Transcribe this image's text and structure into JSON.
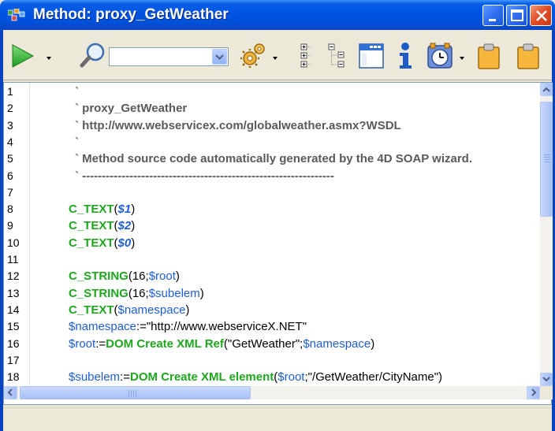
{
  "window": {
    "title": "Method: proxy_GetWeather",
    "title_icon": "method-icon",
    "controls": [
      "minimize-icon",
      "maximize-icon",
      "close-icon"
    ]
  },
  "toolbar": {
    "run": {
      "icon": "run-icon",
      "has_dropdown": true
    },
    "search": {
      "icon": "magnifier-icon",
      "value": ""
    },
    "settings": {
      "icon": "gears-icon",
      "has_dropdown": true
    },
    "collapse": {
      "icon": "collapse-tree-icon"
    },
    "expand": {
      "icon": "expand-tree-icon"
    },
    "form": {
      "icon": "window-form-icon"
    },
    "info": {
      "icon": "info-icon"
    },
    "clock": {
      "icon": "timer-icon",
      "has_dropdown": true
    },
    "clip1": {
      "icon": "clipboard-icon"
    },
    "clip2": {
      "icon": "clipboard-icon"
    }
  },
  "editor": {
    "line_numbers": [
      "1",
      "2",
      "3",
      "4",
      "5",
      "6",
      "7",
      "8",
      "9",
      "10",
      "11",
      "12",
      "13",
      "14",
      "15",
      "16",
      "17",
      "18"
    ],
    "lines": [
      {
        "parts": [
          {
            "t": "`",
            "c": "comment"
          }
        ],
        "indent": 56
      },
      {
        "parts": [
          {
            "t": "` proxy_GetWeather",
            "c": "comment"
          }
        ],
        "indent": 56
      },
      {
        "parts": [
          {
            "t": "` http://www.webservicex.com/globalweather.asmx?WSDL",
            "c": "comment"
          }
        ],
        "indent": 56
      },
      {
        "parts": [
          {
            "t": "`",
            "c": "comment"
          }
        ],
        "indent": 56
      },
      {
        "parts": [
          {
            "t": "` Method source code automatically generated by the 4D SOAP wizard.",
            "c": "comment"
          }
        ],
        "indent": 56
      },
      {
        "parts": [
          {
            "t": "` ----------------------------------------------------------------",
            "c": "comment"
          }
        ],
        "indent": 56
      },
      {
        "parts": [],
        "indent": 48
      },
      {
        "parts": [
          {
            "t": "C_TEXT",
            "c": "cmd"
          },
          {
            "t": "(",
            "c": "plain"
          },
          {
            "t": "$1",
            "c": "param"
          },
          {
            "t": ")",
            "c": "plain"
          }
        ],
        "indent": 48
      },
      {
        "parts": [
          {
            "t": "C_TEXT",
            "c": "cmd"
          },
          {
            "t": "(",
            "c": "plain"
          },
          {
            "t": "$2",
            "c": "param"
          },
          {
            "t": ")",
            "c": "plain"
          }
        ],
        "indent": 48
      },
      {
        "parts": [
          {
            "t": "C_TEXT",
            "c": "cmd"
          },
          {
            "t": "(",
            "c": "plain"
          },
          {
            "t": "$0",
            "c": "param"
          },
          {
            "t": ")",
            "c": "plain"
          }
        ],
        "indent": 48
      },
      {
        "parts": [],
        "indent": 48
      },
      {
        "parts": [
          {
            "t": "C_STRING",
            "c": "cmd"
          },
          {
            "t": "(16;",
            "c": "plain"
          },
          {
            "t": "$root",
            "c": "var"
          },
          {
            "t": ")",
            "c": "plain"
          }
        ],
        "indent": 48
      },
      {
        "parts": [
          {
            "t": "C_STRING",
            "c": "cmd"
          },
          {
            "t": "(16;",
            "c": "plain"
          },
          {
            "t": "$subelem",
            "c": "var"
          },
          {
            "t": ")",
            "c": "plain"
          }
        ],
        "indent": 48
      },
      {
        "parts": [
          {
            "t": "C_TEXT",
            "c": "cmd"
          },
          {
            "t": "(",
            "c": "plain"
          },
          {
            "t": "$namespace",
            "c": "var"
          },
          {
            "t": ")",
            "c": "plain"
          }
        ],
        "indent": 48
      },
      {
        "parts": [
          {
            "t": "$namespace",
            "c": "var"
          },
          {
            "t": ":=\"http://www.webserviceX.NET\"",
            "c": "plain"
          }
        ],
        "indent": 48
      },
      {
        "parts": [
          {
            "t": "$root",
            "c": "var"
          },
          {
            "t": ":=",
            "c": "plain"
          },
          {
            "t": "DOM Create XML Ref",
            "c": "cmd"
          },
          {
            "t": "(\"GetWeather\";",
            "c": "plain"
          },
          {
            "t": "$namespace",
            "c": "var"
          },
          {
            "t": ")",
            "c": "plain"
          }
        ],
        "indent": 48
      },
      {
        "parts": [],
        "indent": 48
      },
      {
        "parts": [
          {
            "t": "$subelem",
            "c": "var"
          },
          {
            "t": ":=",
            "c": "plain"
          },
          {
            "t": "DOM Create XML element",
            "c": "cmd"
          },
          {
            "t": "(",
            "c": "plain"
          },
          {
            "t": "$root",
            "c": "var"
          },
          {
            "t": ";\"/GetWeather/CityName\")",
            "c": "plain"
          }
        ],
        "indent": 48
      }
    ]
  },
  "scrollbars": {
    "vertical": {
      "position": 0
    },
    "horizontal": {
      "position": 0
    }
  },
  "statusbar": {
    "text": ""
  }
}
